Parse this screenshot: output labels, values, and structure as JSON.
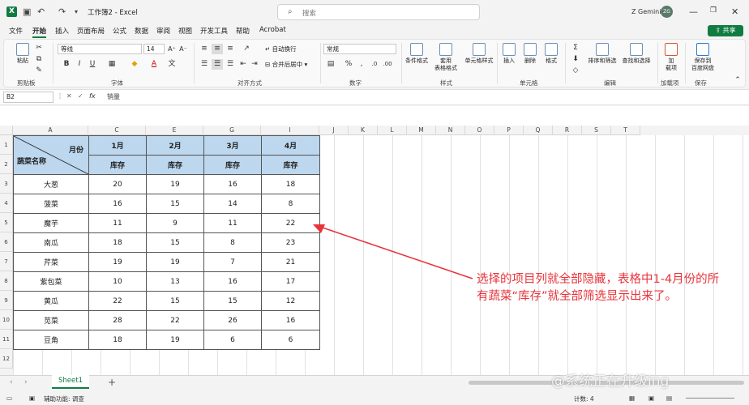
{
  "app": {
    "logo": "X",
    "title": "工作簿2 - Excel",
    "user": "Z Gemini",
    "avatar": "ZG"
  },
  "search": {
    "placeholder": "搜索"
  },
  "menu": [
    "文件",
    "开始",
    "插入",
    "页面布局",
    "公式",
    "数据",
    "审阅",
    "视图",
    "开发工具",
    "帮助",
    "Acrobat"
  ],
  "share_label": "共享",
  "ribbon": {
    "paste": "粘贴",
    "groups": [
      "剪贴板",
      "字体",
      "对齐方式",
      "数字",
      "样式",
      "单元格",
      "编辑",
      "加载项",
      "保存"
    ],
    "font_name": "等线",
    "font_size": "14",
    "wrap": "自动换行",
    "merge": "合并后居中",
    "number_format": "常规",
    "cond_format": "条件格式",
    "table_format": "套用\n表格格式",
    "cell_style": "单元格样式",
    "insert": "插入",
    "delete": "删除",
    "format": "格式",
    "sort_filter": "排序和筛选",
    "find_select": "查找和选择",
    "addins": "加\n载项",
    "save_baidu": "保存到\n百度网盘"
  },
  "formula_bar": {
    "namebox": "B2",
    "fx": "fx",
    "content": "销量"
  },
  "columns": [
    "A",
    "C",
    "E",
    "G",
    "I",
    "J",
    "K",
    "L",
    "M",
    "N",
    "O",
    "P",
    "Q",
    "R",
    "S",
    "T"
  ],
  "rows": [
    "1",
    "2",
    "3",
    "4",
    "5",
    "6",
    "7",
    "8",
    "9",
    "10",
    "11",
    "12"
  ],
  "table": {
    "diag_top": "月份",
    "diag_bottom": "蔬菜名称",
    "months": [
      "1月",
      "2月",
      "3月",
      "4月"
    ],
    "sub": [
      "库存",
      "库存",
      "库存",
      "库存"
    ],
    "data": [
      [
        "大葱",
        "20",
        "19",
        "16",
        "18"
      ],
      [
        "菠菜",
        "16",
        "15",
        "14",
        "8"
      ],
      [
        "魔芋",
        "11",
        "9",
        "11",
        "22"
      ],
      [
        "南瓜",
        "18",
        "15",
        "8",
        "23"
      ],
      [
        "芹菜",
        "19",
        "19",
        "7",
        "21"
      ],
      [
        "紫包菜",
        "10",
        "13",
        "16",
        "17"
      ],
      [
        "黄瓜",
        "22",
        "15",
        "15",
        "12"
      ],
      [
        "苋菜",
        "28",
        "22",
        "26",
        "16"
      ],
      [
        "豆角",
        "18",
        "19",
        "6",
        "6"
      ]
    ]
  },
  "annotation": {
    "line1": "选择的项目列就全部隐藏，表格中1-4月份的所",
    "line2": "有蔬菜“库存”就全部筛选显示出来了。"
  },
  "sheet_tab": "Sheet1",
  "status": {
    "accessibility": "辅助功能: 调查",
    "count": "计数: 4"
  },
  "watermark": "@系统正在升级ing",
  "colors": {
    "accent": "#107c41",
    "header_fill": "#bcd7ee",
    "annotation": "#e8333a"
  }
}
